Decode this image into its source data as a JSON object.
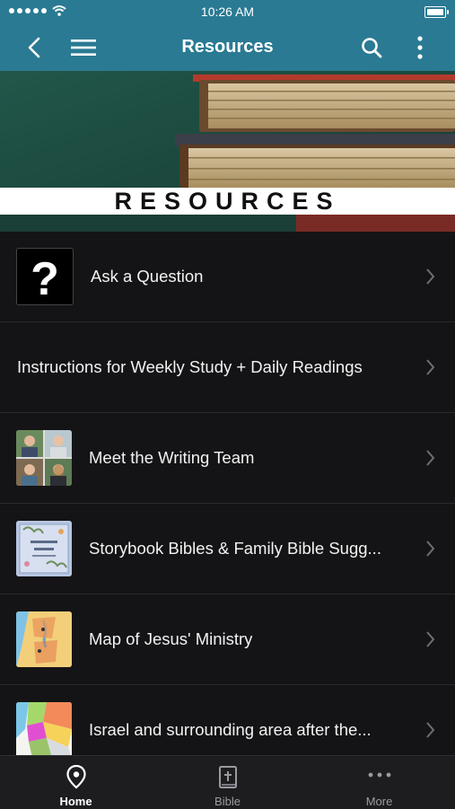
{
  "status_bar": {
    "time": "10:26 AM"
  },
  "header": {
    "title": "Resources"
  },
  "hero": {
    "banner_text": "RESOURCES"
  },
  "list": [
    {
      "label": "Ask a Question",
      "thumb": "question-mark"
    },
    {
      "label": "Instructions for Weekly Study + Daily Readings",
      "thumb": ""
    },
    {
      "label": "Meet the Writing Team",
      "thumb": "team-photos"
    },
    {
      "label": "Storybook Bibles & Family Bible Sugg...",
      "thumb": "book-cover"
    },
    {
      "label": "Map of Jesus' Ministry",
      "thumb": "map"
    },
    {
      "label": "Israel and surrounding area after the...",
      "thumb": "color-map"
    }
  ],
  "tabs": [
    {
      "label": "Home",
      "icon": "location-pin-icon",
      "active": true
    },
    {
      "label": "Bible",
      "icon": "bible-icon",
      "active": false
    },
    {
      "label": "More",
      "icon": "more-dots-icon",
      "active": false
    }
  ],
  "colors": {
    "header_bg": "#2a7a93",
    "list_bg": "#141416",
    "tabbar_bg": "#1d1d20"
  }
}
